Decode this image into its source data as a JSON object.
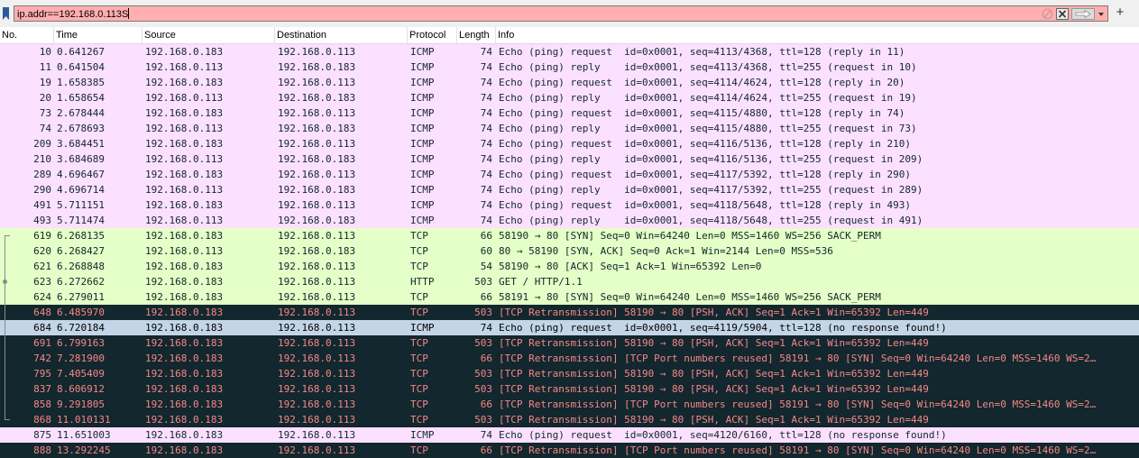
{
  "filter": {
    "value": "ip.addr==192.168.0.113S"
  },
  "icons": {
    "bookmark": "bookmark-icon",
    "clear": "clear-filter-icon",
    "close": "close-icon",
    "apply": "apply-arrow-icon",
    "dropdown": "dropdown-icon",
    "add": "add-filter-icon"
  },
  "colors": {
    "filter_invalid": "#ffafaf",
    "icmp": "#fce0ff",
    "tcp_http": "#e4ffc7",
    "bad_tcp_bg": "#12272e",
    "bad_tcp_fg": "#f78787",
    "selected_row": "#c3d5e6"
  },
  "columns": [
    "No.",
    "Time",
    "Source",
    "Destination",
    "Protocol",
    "Length",
    "Info"
  ],
  "packets": [
    {
      "no": "10",
      "time": "0.641267",
      "src": "192.168.0.183",
      "dst": "192.168.0.113",
      "proto": "ICMP",
      "len": "74",
      "info": "Echo (ping) request  id=0x0001, seq=4113/4368, ttl=128 (reply in 11)",
      "style": "icmp",
      "rel": ""
    },
    {
      "no": "11",
      "time": "0.641504",
      "src": "192.168.0.113",
      "dst": "192.168.0.183",
      "proto": "ICMP",
      "len": "74",
      "info": "Echo (ping) reply    id=0x0001, seq=4113/4368, ttl=255 (request in 10)",
      "style": "icmp",
      "rel": ""
    },
    {
      "no": "19",
      "time": "1.658385",
      "src": "192.168.0.183",
      "dst": "192.168.0.113",
      "proto": "ICMP",
      "len": "74",
      "info": "Echo (ping) request  id=0x0001, seq=4114/4624, ttl=128 (reply in 20)",
      "style": "icmp",
      "rel": ""
    },
    {
      "no": "20",
      "time": "1.658654",
      "src": "192.168.0.113",
      "dst": "192.168.0.183",
      "proto": "ICMP",
      "len": "74",
      "info": "Echo (ping) reply    id=0x0001, seq=4114/4624, ttl=255 (request in 19)",
      "style": "icmp",
      "rel": ""
    },
    {
      "no": "73",
      "time": "2.678444",
      "src": "192.168.0.183",
      "dst": "192.168.0.113",
      "proto": "ICMP",
      "len": "74",
      "info": "Echo (ping) request  id=0x0001, seq=4115/4880, ttl=128 (reply in 74)",
      "style": "icmp",
      "rel": ""
    },
    {
      "no": "74",
      "time": "2.678693",
      "src": "192.168.0.113",
      "dst": "192.168.0.183",
      "proto": "ICMP",
      "len": "74",
      "info": "Echo (ping) reply    id=0x0001, seq=4115/4880, ttl=255 (request in 73)",
      "style": "icmp",
      "rel": ""
    },
    {
      "no": "209",
      "time": "3.684451",
      "src": "192.168.0.183",
      "dst": "192.168.0.113",
      "proto": "ICMP",
      "len": "74",
      "info": "Echo (ping) request  id=0x0001, seq=4116/5136, ttl=128 (reply in 210)",
      "style": "icmp",
      "rel": ""
    },
    {
      "no": "210",
      "time": "3.684689",
      "src": "192.168.0.113",
      "dst": "192.168.0.183",
      "proto": "ICMP",
      "len": "74",
      "info": "Echo (ping) reply    id=0x0001, seq=4116/5136, ttl=255 (request in 209)",
      "style": "icmp",
      "rel": ""
    },
    {
      "no": "289",
      "time": "4.696467",
      "src": "192.168.0.183",
      "dst": "192.168.0.113",
      "proto": "ICMP",
      "len": "74",
      "info": "Echo (ping) request  id=0x0001, seq=4117/5392, ttl=128 (reply in 290)",
      "style": "icmp",
      "rel": ""
    },
    {
      "no": "290",
      "time": "4.696714",
      "src": "192.168.0.113",
      "dst": "192.168.0.183",
      "proto": "ICMP",
      "len": "74",
      "info": "Echo (ping) reply    id=0x0001, seq=4117/5392, ttl=255 (request in 289)",
      "style": "icmp",
      "rel": ""
    },
    {
      "no": "491",
      "time": "5.711151",
      "src": "192.168.0.183",
      "dst": "192.168.0.113",
      "proto": "ICMP",
      "len": "74",
      "info": "Echo (ping) request  id=0x0001, seq=4118/5648, ttl=128 (reply in 493)",
      "style": "icmp",
      "rel": ""
    },
    {
      "no": "493",
      "time": "5.711474",
      "src": "192.168.0.113",
      "dst": "192.168.0.183",
      "proto": "ICMP",
      "len": "74",
      "info": "Echo (ping) reply    id=0x0001, seq=4118/5648, ttl=255 (request in 491)",
      "style": "icmp",
      "rel": ""
    },
    {
      "no": "619",
      "time": "6.268135",
      "src": "192.168.0.183",
      "dst": "192.168.0.113",
      "proto": "TCP",
      "len": "66",
      "info": "58190 → 80 [SYN] Seq=0 Win=64240 Len=0 MSS=1460 WS=256 SACK_PERM",
      "style": "tcp",
      "rel": "start"
    },
    {
      "no": "620",
      "time": "6.268427",
      "src": "192.168.0.113",
      "dst": "192.168.0.183",
      "proto": "TCP",
      "len": "60",
      "info": "80 → 58190 [SYN, ACK] Seq=0 Ack=1 Win=2144 Len=0 MSS=536",
      "style": "tcp",
      "rel": "mid"
    },
    {
      "no": "621",
      "time": "6.268848",
      "src": "192.168.0.183",
      "dst": "192.168.0.113",
      "proto": "TCP",
      "len": "54",
      "info": "58190 → 80 [ACK] Seq=1 Ack=1 Win=65392 Len=0",
      "style": "tcp",
      "rel": "mid"
    },
    {
      "no": "623",
      "time": "6.272662",
      "src": "192.168.0.183",
      "dst": "192.168.0.113",
      "proto": "HTTP",
      "len": "503",
      "info": "GET / HTTP/1.1",
      "style": "tcp",
      "rel": "dot"
    },
    {
      "no": "624",
      "time": "6.279011",
      "src": "192.168.0.183",
      "dst": "192.168.0.113",
      "proto": "TCP",
      "len": "66",
      "info": "58191 → 80 [SYN] Seq=0 Win=64240 Len=0 MSS=1460 WS=256 SACK_PERM",
      "style": "tcp",
      "rel": "mid"
    },
    {
      "no": "648",
      "time": "6.485970",
      "src": "192.168.0.183",
      "dst": "192.168.0.113",
      "proto": "TCP",
      "len": "503",
      "info": "[TCP Retransmission] 58190 → 80 [PSH, ACK] Seq=1 Ack=1 Win=65392 Len=449",
      "style": "bad",
      "rel": "mid"
    },
    {
      "no": "684",
      "time": "6.720184",
      "src": "192.168.0.183",
      "dst": "192.168.0.113",
      "proto": "ICMP",
      "len": "74",
      "info": "Echo (ping) request  id=0x0001, seq=4119/5904, ttl=128 (no response found!)",
      "style": "selected",
      "rel": "mid"
    },
    {
      "no": "691",
      "time": "6.799163",
      "src": "192.168.0.183",
      "dst": "192.168.0.113",
      "proto": "TCP",
      "len": "503",
      "info": "[TCP Retransmission] 58190 → 80 [PSH, ACK] Seq=1 Ack=1 Win=65392 Len=449",
      "style": "bad",
      "rel": "mid"
    },
    {
      "no": "742",
      "time": "7.281900",
      "src": "192.168.0.183",
      "dst": "192.168.0.113",
      "proto": "TCP",
      "len": "66",
      "info": "[TCP Retransmission] [TCP Port numbers reused] 58191 → 80 [SYN] Seq=0 Win=64240 Len=0 MSS=1460 WS=2…",
      "style": "bad",
      "rel": "mid"
    },
    {
      "no": "795",
      "time": "7.405409",
      "src": "192.168.0.183",
      "dst": "192.168.0.113",
      "proto": "TCP",
      "len": "503",
      "info": "[TCP Retransmission] 58190 → 80 [PSH, ACK] Seq=1 Ack=1 Win=65392 Len=449",
      "style": "bad",
      "rel": "mid"
    },
    {
      "no": "837",
      "time": "8.606912",
      "src": "192.168.0.183",
      "dst": "192.168.0.113",
      "proto": "TCP",
      "len": "503",
      "info": "[TCP Retransmission] 58190 → 80 [PSH, ACK] Seq=1 Ack=1 Win=65392 Len=449",
      "style": "bad",
      "rel": "mid"
    },
    {
      "no": "858",
      "time": "9.291805",
      "src": "192.168.0.183",
      "dst": "192.168.0.113",
      "proto": "TCP",
      "len": "66",
      "info": "[TCP Retransmission] [TCP Port numbers reused] 58191 → 80 [SYN] Seq=0 Win=64240 Len=0 MSS=1460 WS=2…",
      "style": "bad",
      "rel": "mid"
    },
    {
      "no": "868",
      "time": "11.010131",
      "src": "192.168.0.183",
      "dst": "192.168.0.113",
      "proto": "TCP",
      "len": "503",
      "info": "[TCP Retransmission] 58190 → 80 [PSH, ACK] Seq=1 Ack=1 Win=65392 Len=449",
      "style": "bad",
      "rel": "end"
    },
    {
      "no": "875",
      "time": "11.651003",
      "src": "192.168.0.183",
      "dst": "192.168.0.113",
      "proto": "ICMP",
      "len": "74",
      "info": "Echo (ping) request  id=0x0001, seq=4120/6160, ttl=128 (no response found!)",
      "style": "icmp",
      "rel": ""
    },
    {
      "no": "888",
      "time": "13.292245",
      "src": "192.168.0.183",
      "dst": "192.168.0.113",
      "proto": "TCP",
      "len": "66",
      "info": "[TCP Retransmission] [TCP Port numbers reused] 58191 → 80 [SYN] Seq=0 Win=64240 Len=0 MSS=1460 WS=2…",
      "style": "bad",
      "rel": ""
    }
  ]
}
